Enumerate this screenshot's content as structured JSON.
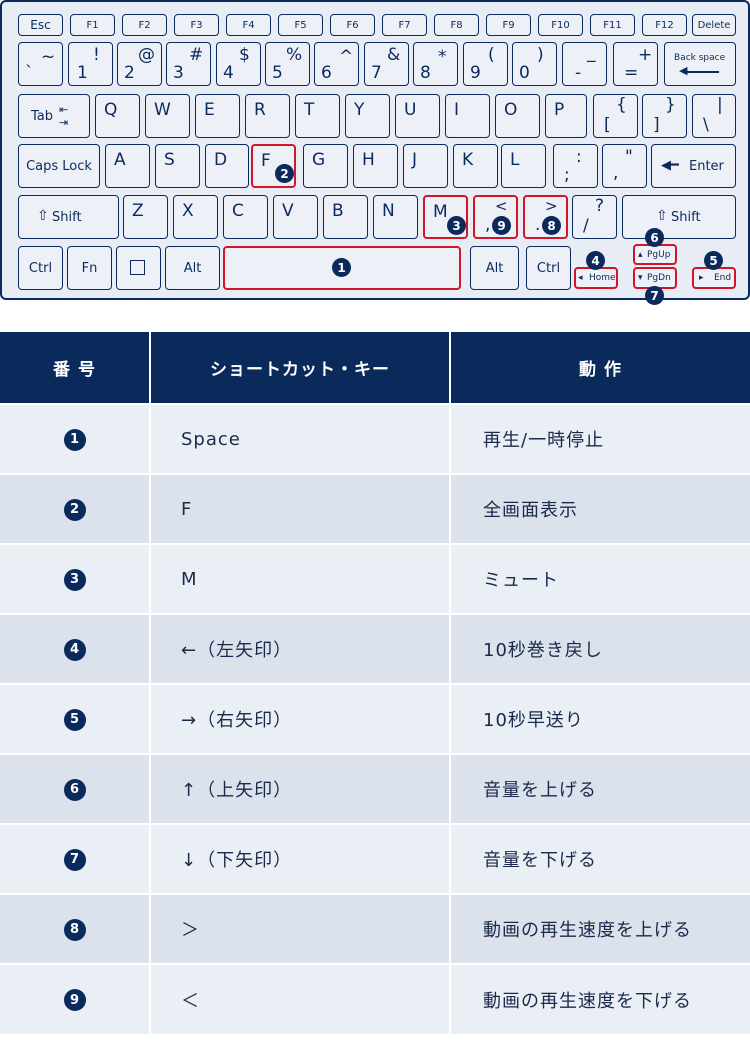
{
  "keyboard": {
    "row_fn": [
      "Esc",
      "F1",
      "F2",
      "F3",
      "F4",
      "F5",
      "F6",
      "F7",
      "F8",
      "F9",
      "F10",
      "F11",
      "F12",
      "Delete"
    ],
    "row_num": [
      {
        "top": "~",
        "bot": "`"
      },
      {
        "top": "!",
        "bot": "1"
      },
      {
        "top": "@",
        "bot": "2"
      },
      {
        "top": "#",
        "bot": "3"
      },
      {
        "top": "$",
        "bot": "4"
      },
      {
        "top": "%",
        "bot": "5"
      },
      {
        "top": "^",
        "bot": "6"
      },
      {
        "top": "&",
        "bot": "7"
      },
      {
        "top": "*",
        "bot": "8"
      },
      {
        "top": "(",
        "bot": "9"
      },
      {
        "top": ")",
        "bot": "0"
      },
      {
        "top": "_",
        "bot": "-"
      },
      {
        "top": "+",
        "bot": "="
      }
    ],
    "backspace": "Back space",
    "tab": "Tab",
    "row_q": [
      "Q",
      "W",
      "E",
      "R",
      "T",
      "Y",
      "U",
      "I",
      "O",
      "P"
    ],
    "bracket_open": {
      "top": "{",
      "bot": "["
    },
    "bracket_close": {
      "top": "}",
      "bot": "]"
    },
    "backslash": {
      "top": "|",
      "bot": "\\"
    },
    "caps_lock": "Caps Lock",
    "row_a": [
      "A",
      "S",
      "D",
      "F",
      "G",
      "H",
      "J",
      "K",
      "L"
    ],
    "semicolon": {
      "top": ":",
      "bot": ";"
    },
    "quote": {
      "top": "\"",
      "bot": ","
    },
    "enter": "Enter",
    "shift": "Shift",
    "row_z": [
      "Z",
      "X",
      "C",
      "V",
      "B",
      "N",
      "M"
    ],
    "comma": {
      "top": "<",
      "bot": ","
    },
    "period": {
      "top": ">",
      "bot": "."
    },
    "slash": {
      "top": "?",
      "bot": "/"
    },
    "ctrl": "Ctrl",
    "fn": "Fn",
    "alt": "Alt",
    "home": "Home",
    "pgup": "PgUp",
    "pgdn": "PgDn",
    "end": "End",
    "badges": [
      "1",
      "2",
      "3",
      "4",
      "5",
      "6",
      "7",
      "8",
      "9"
    ]
  },
  "table": {
    "headers": [
      "番 号",
      "ショートカット・キー",
      "動 作"
    ],
    "rows": [
      {
        "num": "1",
        "key": "Space",
        "action": "再生/一時停止"
      },
      {
        "num": "2",
        "key": "F",
        "action": "全画面表示"
      },
      {
        "num": "3",
        "key": "M",
        "action": "ミュート"
      },
      {
        "num": "4",
        "key": "←（左矢印）",
        "action": "10秒巻き戻し"
      },
      {
        "num": "5",
        "key": "→（右矢印）",
        "action": "10秒早送り"
      },
      {
        "num": "6",
        "key": "↑（上矢印）",
        "action": "音量を上げる"
      },
      {
        "num": "7",
        "key": "↓（下矢印）",
        "action": "音量を下げる"
      },
      {
        "num": "8",
        "key": "＞",
        "action": "動画の再生速度を上げる"
      },
      {
        "num": "9",
        "key": "＜",
        "action": "動画の再生速度を下げる"
      }
    ]
  },
  "colors": {
    "navy": "#0b2a5c",
    "highlight": "#d2162a",
    "row_light": "#eaeef5",
    "row_dark": "#dbe2ec"
  }
}
